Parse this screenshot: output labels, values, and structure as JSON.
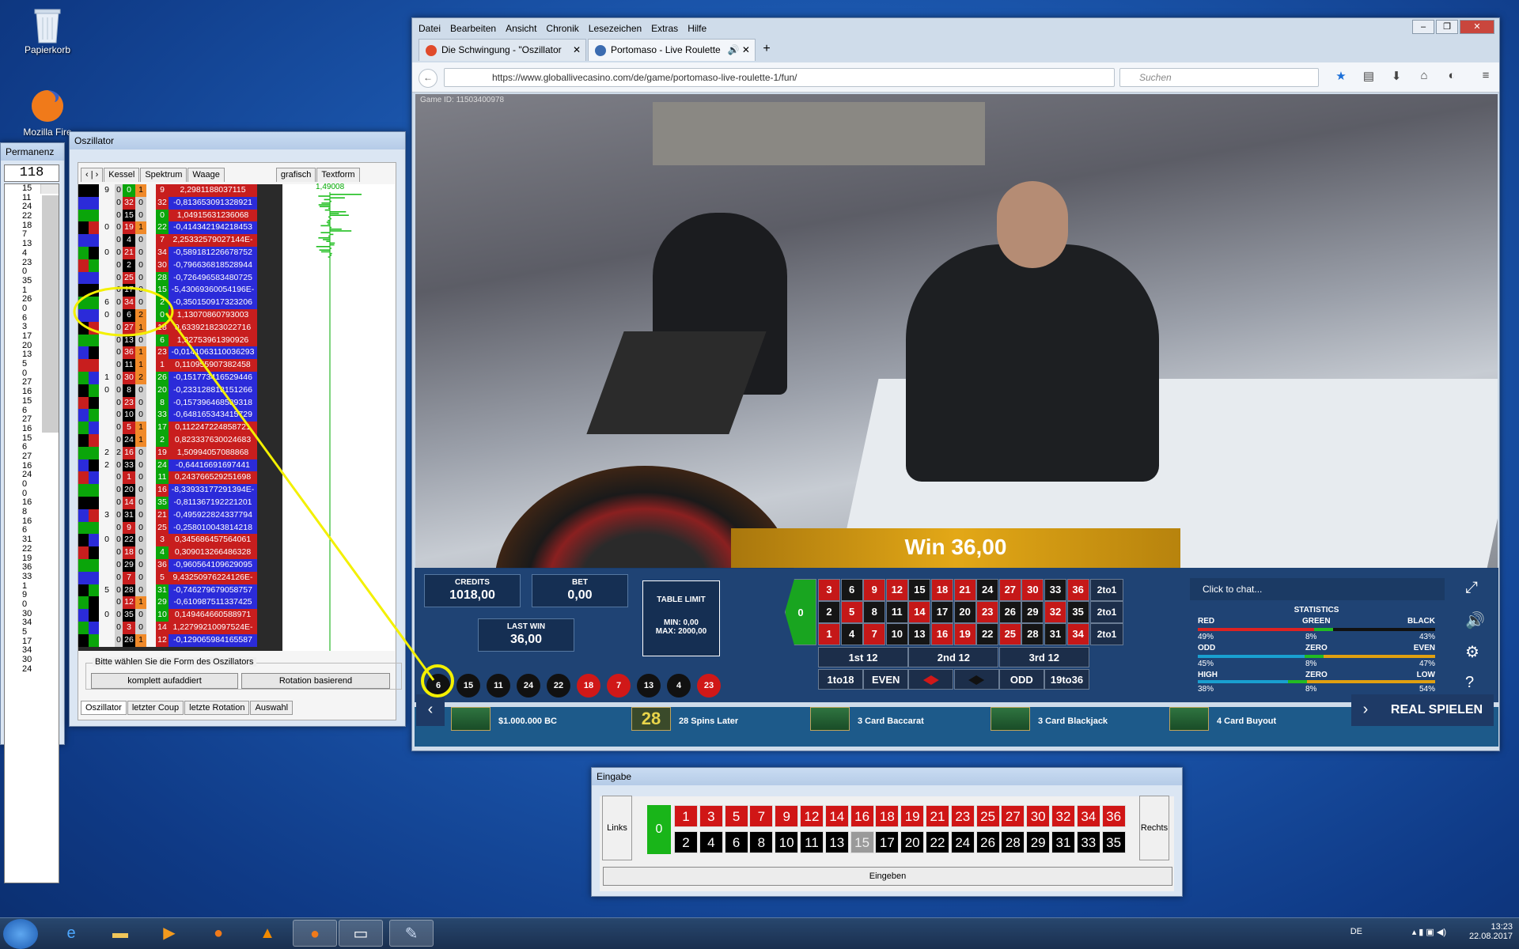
{
  "desktop": {
    "icons": [
      {
        "label": "Papierkorb",
        "icon": "recycle-bin-icon"
      },
      {
        "label": "Mozilla Fire",
        "icon": "firefox-icon"
      }
    ]
  },
  "permanenz": {
    "title": "Permanenz",
    "count": "118",
    "numbers": [
      "15",
      "11",
      "24",
      "22",
      "18",
      "7",
      "13",
      "4",
      "23",
      "0",
      "35",
      "1",
      "26",
      "0",
      "6",
      "3",
      "17",
      "20",
      "13",
      "5",
      "0",
      "27",
      "16",
      "15",
      "6",
      "27",
      "16",
      "15",
      "6",
      "27",
      "16",
      "24",
      "0",
      "0",
      "16",
      "8",
      "16",
      "6",
      "31",
      "22",
      "19",
      "36",
      "33",
      "1",
      "9",
      "0",
      "30",
      "34",
      "5",
      "17",
      "34",
      "30",
      "24"
    ]
  },
  "oszillator": {
    "title": "Oszillator",
    "tabs_top": [
      "‹ | ›",
      "Kessel",
      "Spektrum",
      "Waage",
      "grafisch",
      "Textform"
    ],
    "graph_label": "1,49008",
    "group_label": "Bitte wählen Sie die Form des Oszillators",
    "btn_left": "komplett aufaddiert",
    "btn_right": "Rotation basierend",
    "tabs_bottom": [
      "Oszillator",
      "letzter Coup",
      "letzte Rotation",
      "Auswahl"
    ],
    "colors": {
      "red": "#c81e1e",
      "blue": "#2b2bd9",
      "green": "#0aa50a",
      "black": "#000000"
    },
    "rows": [
      {
        "kessel": "9",
        "a": "0",
        "b": "0",
        "c": "1",
        "n": "9",
        "val": "2,2981188037115",
        "vc": "red"
      },
      {
        "kessel": "",
        "a": "0",
        "b": "32",
        "c": "0",
        "n": "32",
        "val": "-0,813653091328921",
        "vc": "blue"
      },
      {
        "kessel": "",
        "a": "0",
        "b": "15",
        "c": "0",
        "n": "0",
        "val": "1,04915631236068",
        "vc": "red"
      },
      {
        "kessel": "0",
        "a": "0",
        "b": "19",
        "c": "1",
        "n": "22",
        "val": "-0,414342194218453",
        "vc": "blue"
      },
      {
        "kessel": "",
        "a": "0",
        "b": "4",
        "c": "0",
        "n": "7",
        "val": "2,25332579027144E-02",
        "vc": "red"
      },
      {
        "kessel": "0",
        "a": "0",
        "b": "21",
        "c": "0",
        "n": "34",
        "val": "-0,589181226678752",
        "vc": "blue"
      },
      {
        "kessel": "",
        "a": "0",
        "b": "2",
        "c": "0",
        "n": "30",
        "val": "-0,796636818528944",
        "vc": "blue"
      },
      {
        "kessel": "",
        "a": "0",
        "b": "25",
        "c": "0",
        "n": "28",
        "val": "-0,726496583480725",
        "vc": "blue"
      },
      {
        "kessel": "",
        "a": "0",
        "b": "17",
        "c": "0",
        "n": "15",
        "val": "-5,43069360054196E-02",
        "vc": "blue"
      },
      {
        "kessel": "6",
        "a": "0",
        "b": "34",
        "c": "0",
        "n": "2",
        "val": "-0,350150917323206",
        "vc": "blue"
      },
      {
        "kessel": "0",
        "a": "0",
        "b": "6",
        "c": "2",
        "n": "0",
        "val": "1,13070860793003",
        "vc": "red"
      },
      {
        "kessel": "",
        "a": "0",
        "b": "27",
        "c": "1",
        "n": "18",
        "val": "0,633921823022716",
        "vc": "red"
      },
      {
        "kessel": "",
        "a": "0",
        "b": "13",
        "c": "0",
        "n": "6",
        "val": "1,32753961390926",
        "vc": "red"
      },
      {
        "kessel": "",
        "a": "0",
        "b": "36",
        "c": "1",
        "n": "23",
        "val": "-0,0141063110036293",
        "vc": "blue"
      },
      {
        "kessel": "",
        "a": "0",
        "b": "11",
        "c": "1",
        "n": "1",
        "val": "0,110955907382458",
        "vc": "red"
      },
      {
        "kessel": "1",
        "a": "0",
        "b": "30",
        "c": "2",
        "n": "26",
        "val": "-0,151773416529446",
        "vc": "blue"
      },
      {
        "kessel": "0",
        "a": "0",
        "b": "8",
        "c": "0",
        "n": "20",
        "val": "-0,233128818151266",
        "vc": "blue"
      },
      {
        "kessel": "",
        "a": "0",
        "b": "23",
        "c": "0",
        "n": "8",
        "val": "-0,157396468589318",
        "vc": "blue"
      },
      {
        "kessel": "",
        "a": "0",
        "b": "10",
        "c": "0",
        "n": "33",
        "val": "-0,648165343415729",
        "vc": "blue"
      },
      {
        "kessel": "",
        "a": "0",
        "b": "5",
        "c": "1",
        "n": "17",
        "val": "0,112247224858721",
        "vc": "red"
      },
      {
        "kessel": "",
        "a": "0",
        "b": "24",
        "c": "1",
        "n": "2",
        "val": "0,823337630024683",
        "vc": "red"
      },
      {
        "kessel": "2",
        "a": "2",
        "b": "16",
        "c": "0",
        "n": "19",
        "val": "1,50994057088868",
        "vc": "red"
      },
      {
        "kessel": "2",
        "a": "0",
        "b": "33",
        "c": "0",
        "n": "24",
        "val": "-0,64416691697441",
        "vc": "blue"
      },
      {
        "kessel": "",
        "a": "0",
        "b": "1",
        "c": "0",
        "n": "11",
        "val": "0,243766529251698",
        "vc": "red"
      },
      {
        "kessel": "",
        "a": "0",
        "b": "20",
        "c": "0",
        "n": "16",
        "val": "-8,33933177291394E-02",
        "vc": "blue"
      },
      {
        "kessel": "",
        "a": "0",
        "b": "14",
        "c": "0",
        "n": "35",
        "val": "-0,811367192221201",
        "vc": "blue"
      },
      {
        "kessel": "3",
        "a": "0",
        "b": "31",
        "c": "0",
        "n": "21",
        "val": "-0,495922824337794",
        "vc": "blue"
      },
      {
        "kessel": "",
        "a": "0",
        "b": "9",
        "c": "0",
        "n": "25",
        "val": "-0,258010043814218",
        "vc": "blue"
      },
      {
        "kessel": "0",
        "a": "0",
        "b": "22",
        "c": "0",
        "n": "3",
        "val": "0,345686457564061",
        "vc": "red"
      },
      {
        "kessel": "",
        "a": "0",
        "b": "18",
        "c": "0",
        "n": "4",
        "val": "0,309013266486328",
        "vc": "red"
      },
      {
        "kessel": "",
        "a": "0",
        "b": "29",
        "c": "0",
        "n": "36",
        "val": "-0,960564109629095",
        "vc": "blue"
      },
      {
        "kessel": "",
        "a": "0",
        "b": "7",
        "c": "0",
        "n": "5",
        "val": "9,43250976224126E-02",
        "vc": "red"
      },
      {
        "kessel": "5",
        "a": "0",
        "b": "28",
        "c": "0",
        "n": "31",
        "val": "-0,746279679058757",
        "vc": "blue"
      },
      {
        "kessel": "",
        "a": "0",
        "b": "12",
        "c": "1",
        "n": "29",
        "val": "-0,610987511337425",
        "vc": "blue"
      },
      {
        "kessel": "0",
        "a": "0",
        "b": "35",
        "c": "0",
        "n": "10",
        "val": "0,149464660588971",
        "vc": "red"
      },
      {
        "kessel": "",
        "a": "0",
        "b": "3",
        "c": "0",
        "n": "14",
        "val": "1,22799210097524E-02",
        "vc": "red"
      },
      {
        "kessel": "",
        "a": "0",
        "b": "26",
        "c": "1",
        "n": "12",
        "val": "-0,129065984165587",
        "vc": "blue"
      }
    ]
  },
  "browser": {
    "menu": [
      "Datei",
      "Bearbeiten",
      "Ansicht",
      "Chronik",
      "Lesezeichen",
      "Extras",
      "Hilfe"
    ],
    "tabs": [
      {
        "label": "Die Schwingung - \"Oszillator",
        "active": false
      },
      {
        "label": "Portomaso - Live Roulette",
        "active": true
      }
    ],
    "url": "https://www.globallivecasino.com/de/game/portomaso-live-roulette-1/fun/",
    "search_placeholder": "Suchen"
  },
  "casino": {
    "game_id": "Game ID: 11503400978",
    "win_banner": "Win 36,00",
    "credits_label": "CREDITS",
    "credits": "1018,00",
    "bet_label": "BET",
    "bet": "0,00",
    "last_win_label": "LAST WIN",
    "last_win": "36,00",
    "table_limit_label": "TABLE LIMIT",
    "table_min": "MIN: 0,00",
    "table_max": "MAX: 2000,00",
    "history": [
      {
        "n": "6",
        "c": "black"
      },
      {
        "n": "15",
        "c": "black"
      },
      {
        "n": "11",
        "c": "black"
      },
      {
        "n": "24",
        "c": "black"
      },
      {
        "n": "22",
        "c": "black"
      },
      {
        "n": "18",
        "c": "red"
      },
      {
        "n": "7",
        "c": "red"
      },
      {
        "n": "13",
        "c": "black"
      },
      {
        "n": "4",
        "c": "black"
      },
      {
        "n": "23",
        "c": "red"
      }
    ],
    "table_rows": [
      [
        "3",
        "6",
        "9",
        "12",
        "15",
        "18",
        "21",
        "24",
        "27",
        "30",
        "33",
        "36"
      ],
      [
        "2",
        "5",
        "8",
        "11",
        "14",
        "17",
        "20",
        "23",
        "26",
        "29",
        "32",
        "35"
      ],
      [
        "1",
        "4",
        "7",
        "10",
        "13",
        "16",
        "19",
        "22",
        "25",
        "28",
        "31",
        "34"
      ]
    ],
    "red_numbers": [
      "3",
      "9",
      "12",
      "18",
      "21",
      "27",
      "30",
      "36",
      "5",
      "14",
      "23",
      "32",
      "1",
      "7",
      "16",
      "19",
      "25",
      "34"
    ],
    "column_bets": [
      "2to1",
      "2to1",
      "2to1"
    ],
    "dozens": [
      "1st 12",
      "2nd 12",
      "3rd 12"
    ],
    "outside": [
      "1to18",
      "EVEN",
      "",
      "",
      "ODD",
      "19to36"
    ],
    "chat_placeholder": "Click to chat...",
    "stats": {
      "title": "STATISTICS",
      "row1": {
        "l": "RED",
        "m": "GREEN",
        "r": "BLACK",
        "lv": "49%",
        "mv": "8%",
        "rv": "43%"
      },
      "row2": {
        "l": "ODD",
        "m": "ZERO",
        "r": "EVEN",
        "lv": "45%",
        "mv": "8%",
        "rv": "47%"
      },
      "row3": {
        "l": "HIGH",
        "m": "ZERO",
        "r": "LOW",
        "lv": "38%",
        "mv": "8%",
        "rv": "54%"
      }
    },
    "promos": [
      "$1.000.000 BC",
      "28 Spins Later",
      "3 Card Baccarat",
      "3 Card Blackjack",
      "4 Card Buyout"
    ],
    "promo_badge": "28",
    "real_button": "REAL SPIELEN"
  },
  "eingabe": {
    "title": "Eingabe",
    "left_label": "Links",
    "right_label": "Rechts",
    "zero": "0",
    "top_row": [
      "1",
      "3",
      "5",
      "7",
      "9",
      "12",
      "14",
      "16",
      "18",
      "19",
      "21",
      "23",
      "25",
      "27",
      "30",
      "32",
      "34",
      "36"
    ],
    "bottom_row": [
      "2",
      "4",
      "6",
      "8",
      "10",
      "11",
      "13",
      "15",
      "17",
      "20",
      "22",
      "24",
      "26",
      "28",
      "29",
      "31",
      "33",
      "35"
    ],
    "highlighted": "15",
    "button": "Eingeben"
  },
  "taskbar": {
    "lang": "DE",
    "time": "13:23",
    "date": "22.08.2017"
  }
}
